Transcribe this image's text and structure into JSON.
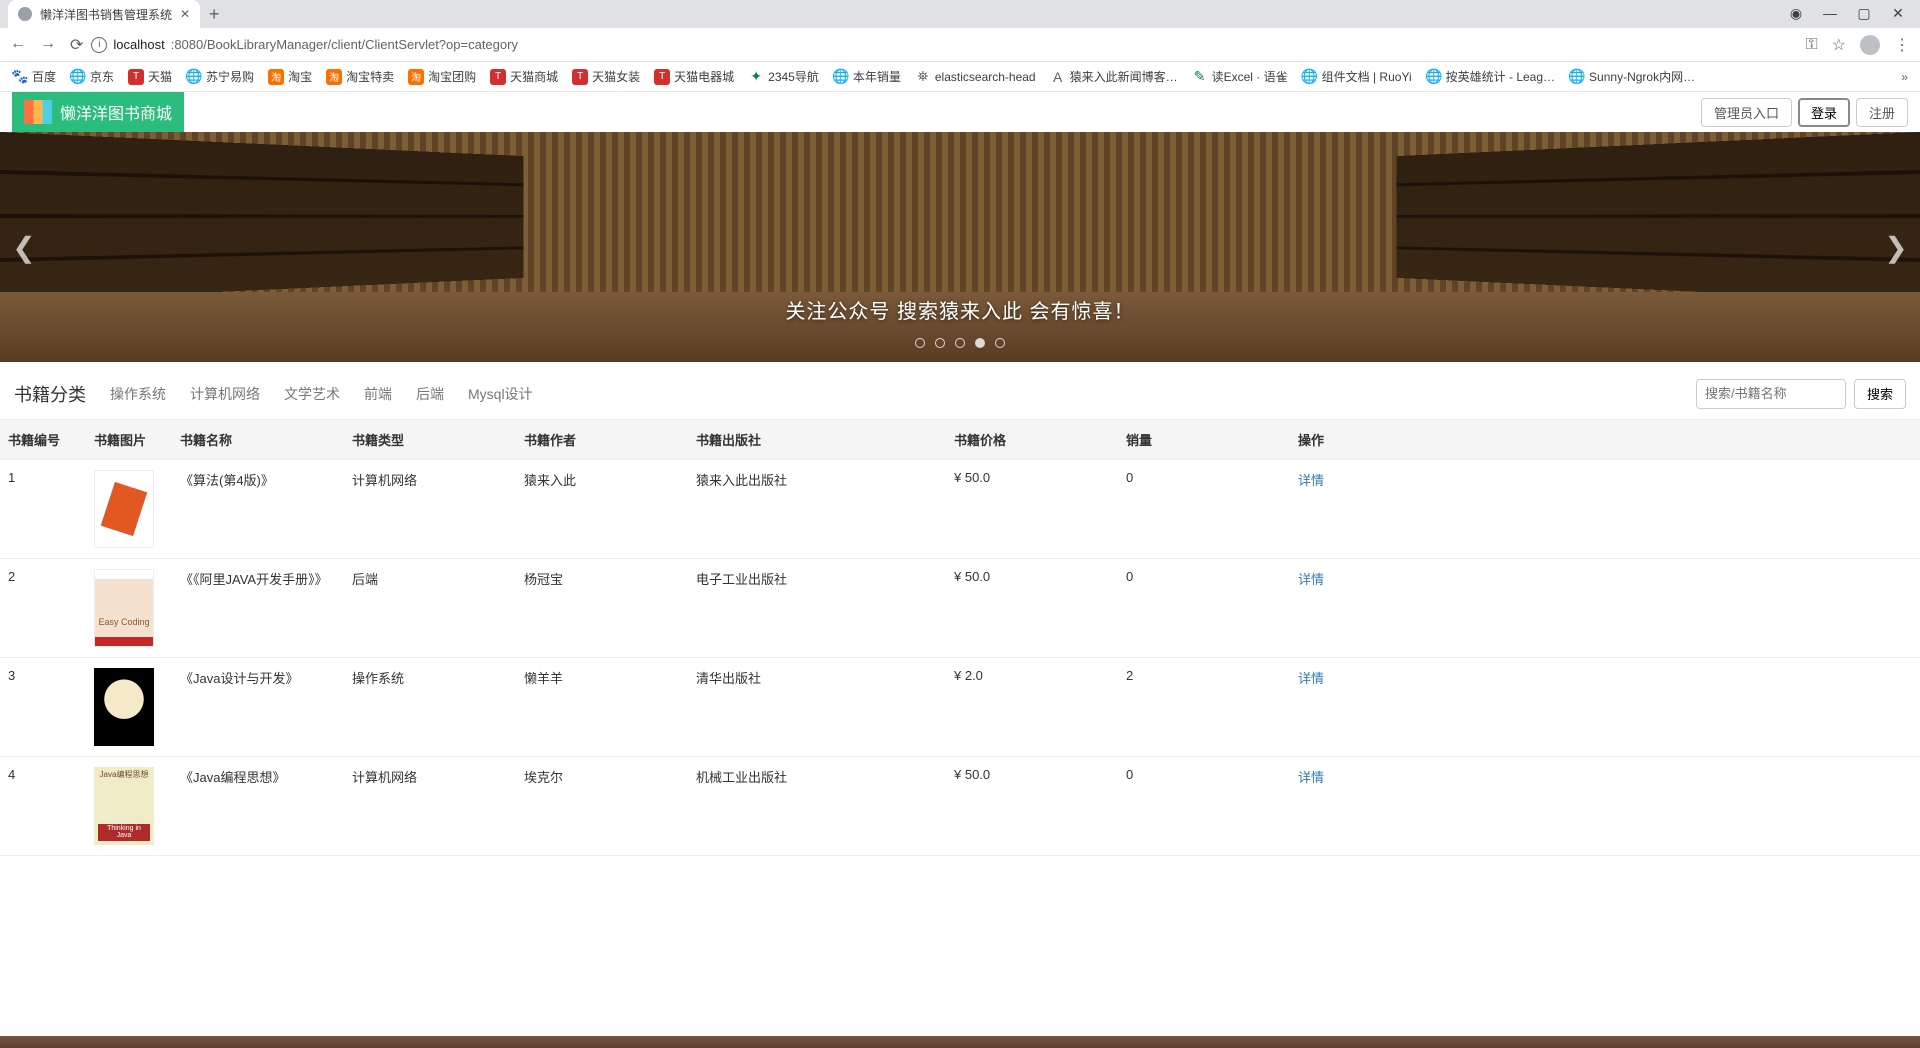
{
  "browser": {
    "tab_title": "懒洋洋图书销售管理系统",
    "url_host": "localhost",
    "url_port_path": ":8080/BookLibraryManager/client/ClientServlet?op=category",
    "win_min": "—",
    "win_max": "▢",
    "win_close": "✕",
    "win_rec": "◉"
  },
  "bookmarks": [
    {
      "label": "百度",
      "ico": "blue",
      "glyph": "🐾"
    },
    {
      "label": "京东",
      "ico": "globe",
      "glyph": "🌐"
    },
    {
      "label": "天猫",
      "ico": "red",
      "glyph": "T"
    },
    {
      "label": "苏宁易购",
      "ico": "globe",
      "glyph": "🌐"
    },
    {
      "label": "淘宝",
      "ico": "orange",
      "glyph": "淘"
    },
    {
      "label": "淘宝特卖",
      "ico": "orange",
      "glyph": "淘"
    },
    {
      "label": "淘宝团购",
      "ico": "orange",
      "glyph": "淘"
    },
    {
      "label": "天猫商城",
      "ico": "red",
      "glyph": "T"
    },
    {
      "label": "天猫女装",
      "ico": "red",
      "glyph": "T"
    },
    {
      "label": "天猫电器城",
      "ico": "red",
      "glyph": "T"
    },
    {
      "label": "2345导航",
      "ico": "green",
      "glyph": "✦"
    },
    {
      "label": "本年销量",
      "ico": "globe",
      "glyph": "🌐"
    },
    {
      "label": "elasticsearch-head",
      "ico": "globe",
      "glyph": "⛯"
    },
    {
      "label": "猿来入此新闻博客…",
      "ico": "globe",
      "glyph": "A"
    },
    {
      "label": "读Excel · 语雀",
      "ico": "green",
      "glyph": "✎"
    },
    {
      "label": "组件文档 | RuoYi",
      "ico": "globe",
      "glyph": "🌐"
    },
    {
      "label": "按英雄统计 - Leag…",
      "ico": "globe",
      "glyph": "🌐"
    },
    {
      "label": "Sunny-Ngrok内网…",
      "ico": "globe",
      "glyph": "🌐"
    }
  ],
  "header": {
    "brand": "懒洋洋图书商城",
    "admin_btn": "管理员入口",
    "login_btn": "登录",
    "register_btn": "注册"
  },
  "carousel": {
    "caption": "关注公众号 搜索猿来入此 会有惊喜！",
    "active_index": 3,
    "count": 5
  },
  "catbar": {
    "title": "书籍分类",
    "cats": [
      "操作系统",
      "计算机网络",
      "文学艺术",
      "前端",
      "后端",
      "Mysql设计"
    ],
    "search_placeholder": "搜索/书籍名称",
    "search_btn": "搜索"
  },
  "table": {
    "headers": [
      "书籍编号",
      "书籍图片",
      "书籍名称",
      "书籍类型",
      "书籍作者",
      "书籍出版社",
      "书籍价格",
      "销量",
      "操作"
    ],
    "detail_label": "详情",
    "currency": "¥",
    "rows": [
      {
        "id": "1",
        "name": "《算法(第4版)》",
        "type": "计算机网络",
        "author": "猿来入此",
        "publisher": "猿来入此出版社",
        "price": "50.0",
        "sales": "0",
        "thumb": "t1",
        "thumb_text": ""
      },
      {
        "id": "2",
        "name": "《《阿里JAVA开发手册》》",
        "type": "后端",
        "author": "杨冠宝",
        "publisher": "电子工业出版社",
        "price": "50.0",
        "sales": "0",
        "thumb": "t2",
        "thumb_text": "Easy Coding"
      },
      {
        "id": "3",
        "name": "《Java设计与开发》",
        "type": "操作系统",
        "author": "懒羊羊",
        "publisher": "清华出版社",
        "price": "2.0",
        "sales": "2",
        "thumb": "t3",
        "thumb_text": ""
      },
      {
        "id": "4",
        "name": "《Java编程思想》",
        "type": "计算机网络",
        "author": "埃克尔",
        "publisher": "机械工业出版社",
        "price": "50.0",
        "sales": "0",
        "thumb": "t4",
        "thumb_text": "Thinking in Java"
      }
    ]
  }
}
